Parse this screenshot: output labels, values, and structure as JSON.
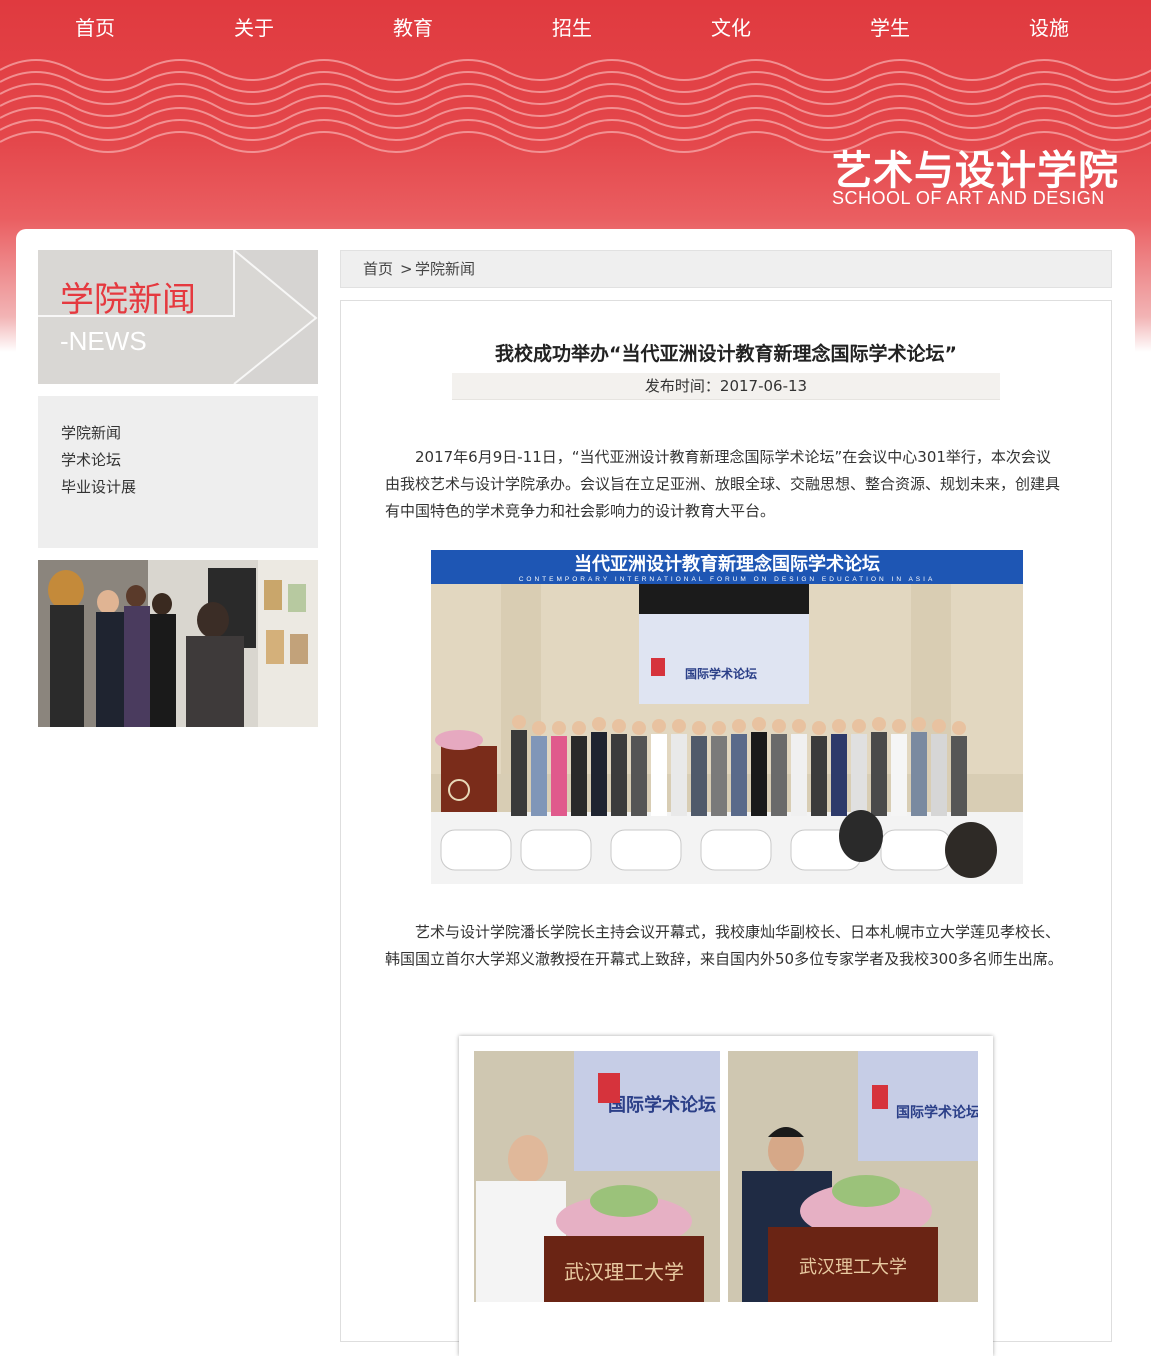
{
  "nav": {
    "items": [
      "首页",
      "关于",
      "教育",
      "招生",
      "文化",
      "学生",
      "设施"
    ]
  },
  "logo": {
    "cn": "艺术与设计学院",
    "en": "SCHOOL OF ART AND DESIGN"
  },
  "sidebar": {
    "title": "学院新闻",
    "subtitle": "-NEWS",
    "menu": [
      "学院新闻",
      "学术论坛",
      "毕业设计展"
    ]
  },
  "breadcrumb": {
    "home": "首页",
    "separator": ">",
    "current": "学院新闻"
  },
  "article": {
    "title": "我校成功举办“当代亚洲设计教育新理念国际学术论坛”",
    "date": "发布时间：2017-06-13",
    "para1": "2017年6月9日-11日，“当代亚洲设计教育新理念国际学术论坛”在会议中心301举行，本次会议由我校艺术与设计学院承办。会议旨在立足亚洲、放眼全球、交融思想、整合资源、规划未来，创建具有中国特色的学术竞争力和社会影响力的设计教育大平台。",
    "para2": "艺术与设计学院潘长学院长主持会议开幕式，我校康灿华副校长、日本札幌市立大学莲见孝校长、韩国国立首尔大学郑义澈教授在开幕式上致辞，来自国内外50多位专家学者及我校300多名师生出席。",
    "banner_cn": "当代亚洲设计教育新理念国际学术论坛",
    "banner_en": "CONTEMPORARY INTERNATIONAL FORUM ON DESIGN EDUCATION IN ASIA",
    "screen_text": "国际学术论坛",
    "podium_text": "武汉理工大学"
  },
  "colors": {
    "brand_red": "#e5393f",
    "banner_red": "#e03a3f"
  }
}
